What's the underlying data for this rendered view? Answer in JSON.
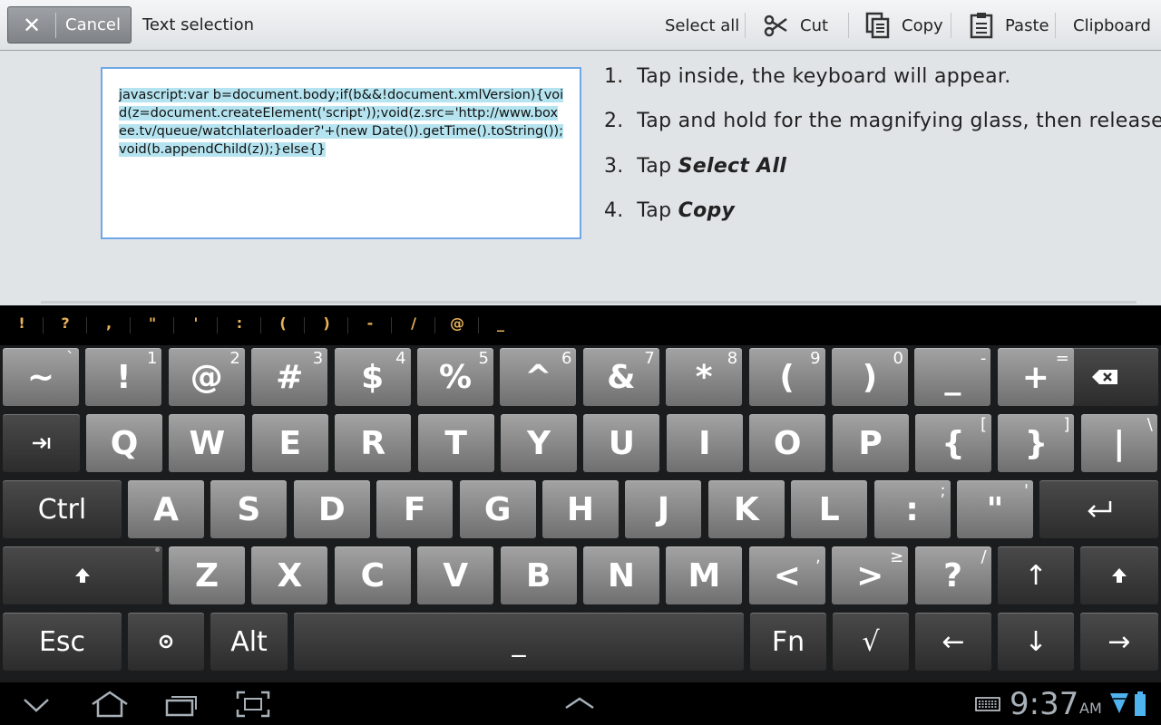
{
  "actionbar": {
    "cancel_label": "Cancel",
    "title": "Text selection",
    "select_all_label": "Select all",
    "cut_label": "Cut",
    "copy_label": "Copy",
    "paste_label": "Paste",
    "clipboard_label": "Clipboard"
  },
  "textbox": {
    "value": "javascript:var b=document.body;if(b&&!document.xmlVersion){void(z=document.createElement('script'));void(z.src='http://www.boxee.tv/queue/watchlaterloader?'+(new Date()).getTime().toString());void(b.appendChild(z));}else{}"
  },
  "steps": [
    {
      "num": "1.",
      "text": "Tap inside, the keyboard will appear.",
      "em": ""
    },
    {
      "num": "2.",
      "text": "Tap and hold for the magnifying glass, then release.",
      "em": ""
    },
    {
      "num": "3.",
      "text": "Tap ",
      "em": "Select All"
    },
    {
      "num": "4.",
      "text": "Tap ",
      "em": "Copy"
    }
  ],
  "symbol_bar": [
    "!",
    "?",
    ",",
    "\"",
    "'",
    ":",
    "(",
    ")",
    "-",
    "/",
    "@",
    "_"
  ],
  "keyboard": {
    "row1": [
      {
        "main": "~",
        "sub": "`"
      },
      {
        "main": "!",
        "sub": "1"
      },
      {
        "main": "@",
        "sub": "2"
      },
      {
        "main": "#",
        "sub": "3"
      },
      {
        "main": "$",
        "sub": "4"
      },
      {
        "main": "%",
        "sub": "5"
      },
      {
        "main": "^",
        "sub": "6"
      },
      {
        "main": "&",
        "sub": "7"
      },
      {
        "main": "*",
        "sub": "8"
      },
      {
        "main": "(",
        "sub": "9"
      },
      {
        "main": ")",
        "sub": "0"
      },
      {
        "main": "_",
        "sub": "-"
      },
      {
        "main": "+",
        "sub": "="
      }
    ],
    "row2": [
      {
        "main": "Q",
        "sub": ""
      },
      {
        "main": "W",
        "sub": ""
      },
      {
        "main": "E",
        "sub": ""
      },
      {
        "main": "R",
        "sub": ""
      },
      {
        "main": "T",
        "sub": ""
      },
      {
        "main": "Y",
        "sub": ""
      },
      {
        "main": "U",
        "sub": ""
      },
      {
        "main": "I",
        "sub": ""
      },
      {
        "main": "O",
        "sub": ""
      },
      {
        "main": "P",
        "sub": ""
      },
      {
        "main": "{",
        "sub": "["
      },
      {
        "main": "}",
        "sub": "]"
      },
      {
        "main": "|",
        "sub": "\\"
      }
    ],
    "row3_ctrl": "Ctrl",
    "row3": [
      {
        "main": "A",
        "sub": ""
      },
      {
        "main": "S",
        "sub": ""
      },
      {
        "main": "D",
        "sub": ""
      },
      {
        "main": "F",
        "sub": ""
      },
      {
        "main": "G",
        "sub": ""
      },
      {
        "main": "H",
        "sub": ""
      },
      {
        "main": "J",
        "sub": ""
      },
      {
        "main": "K",
        "sub": ""
      },
      {
        "main": "L",
        "sub": ""
      },
      {
        "main": ":",
        "sub": ";"
      },
      {
        "main": "\"",
        "sub": "'"
      }
    ],
    "row4": [
      {
        "main": "Z",
        "sub": ""
      },
      {
        "main": "X",
        "sub": ""
      },
      {
        "main": "C",
        "sub": ""
      },
      {
        "main": "V",
        "sub": ""
      },
      {
        "main": "B",
        "sub": ""
      },
      {
        "main": "N",
        "sub": ""
      },
      {
        "main": "M",
        "sub": ""
      },
      {
        "main": "<",
        "sub": ","
      },
      {
        "main": ">",
        "sub": "≥"
      },
      {
        "main": "?",
        "sub": "/"
      }
    ],
    "up_arrow": "↑",
    "esc": "Esc",
    "alt": "Alt",
    "space": "_",
    "fn": "Fn",
    "check": "√",
    "left_arrow": "←",
    "down_arrow": "↓",
    "right_arrow": "→"
  },
  "navbar": {
    "time": "9:37",
    "ampm": "AM"
  }
}
